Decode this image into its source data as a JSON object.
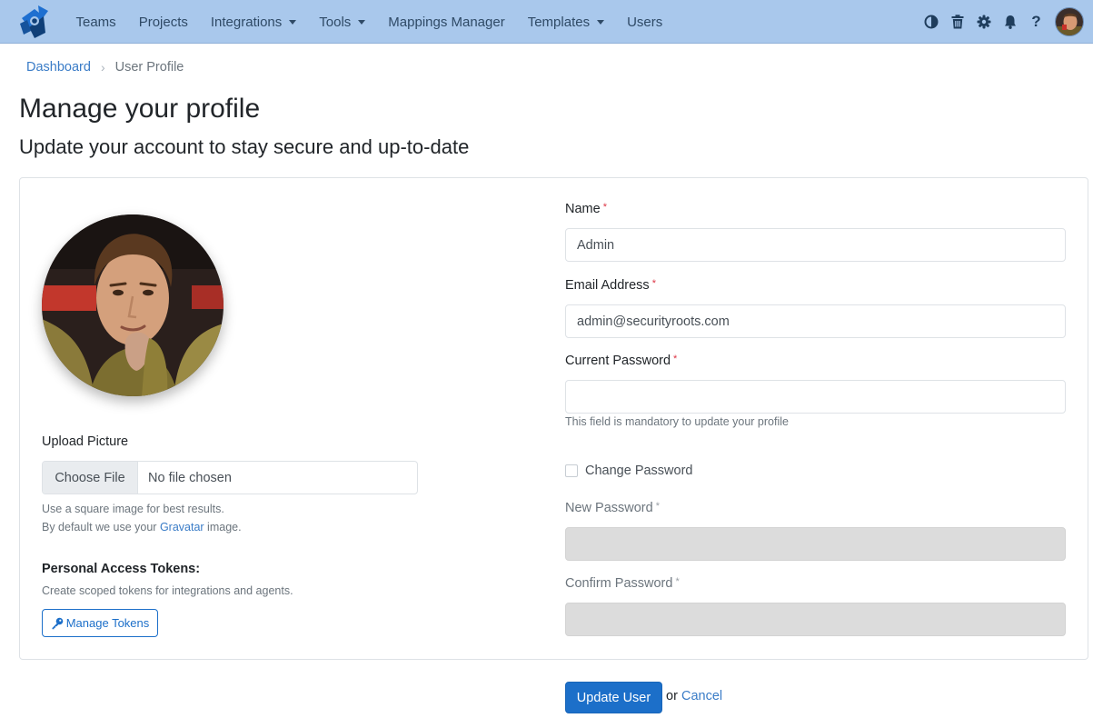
{
  "nav": {
    "brand_icon": "rocket-logo-icon",
    "items": [
      {
        "label": "Teams",
        "dropdown": false
      },
      {
        "label": "Projects",
        "dropdown": false
      },
      {
        "label": "Integrations",
        "dropdown": true
      },
      {
        "label": "Tools",
        "dropdown": true
      },
      {
        "label": "Mappings Manager",
        "dropdown": false
      },
      {
        "label": "Templates",
        "dropdown": true
      },
      {
        "label": "Users",
        "dropdown": false
      }
    ],
    "right_icons": [
      "contrast-icon",
      "trash-icon",
      "gear-icon",
      "bell-icon",
      "help-icon",
      "avatar"
    ],
    "help_glyph": "?"
  },
  "breadcrumb": {
    "home": "Dashboard",
    "separator": "›",
    "current": "User Profile"
  },
  "page": {
    "title": "Manage your profile",
    "subtitle": "Update your account to stay secure and up-to-date"
  },
  "left": {
    "upload_label": "Upload Picture",
    "file_button": "Choose File",
    "file_status": "No file chosen",
    "help_line1": "Use a square image for best results.",
    "help_line2_prefix": "By default we use your ",
    "help_line2_link": "Gravatar",
    "help_line2_suffix": " image.",
    "tokens_heading": "Personal Access Tokens:",
    "tokens_help": "Create scoped tokens for integrations and agents.",
    "tokens_button": "Manage Tokens"
  },
  "form": {
    "required_mark": "*",
    "name_label": "Name",
    "name_value": "Admin",
    "email_label": "Email Address",
    "email_value": "admin@securityroots.com",
    "current_password_label": "Current Password",
    "current_password_value": "",
    "current_password_help": "This field is mandatory to update your profile",
    "change_password_label": "Change Password",
    "change_password_checked": false,
    "new_password_label": "New Password",
    "confirm_password_label": "Confirm Password"
  },
  "actions": {
    "submit": "Update User",
    "or": "or",
    "cancel": "Cancel"
  },
  "colors": {
    "navbar": "#a9c8ec",
    "primary": "#1c6fc9",
    "link": "#3a7cc7",
    "required": "#dc3545",
    "disabled_input": "#dcdcdc"
  }
}
